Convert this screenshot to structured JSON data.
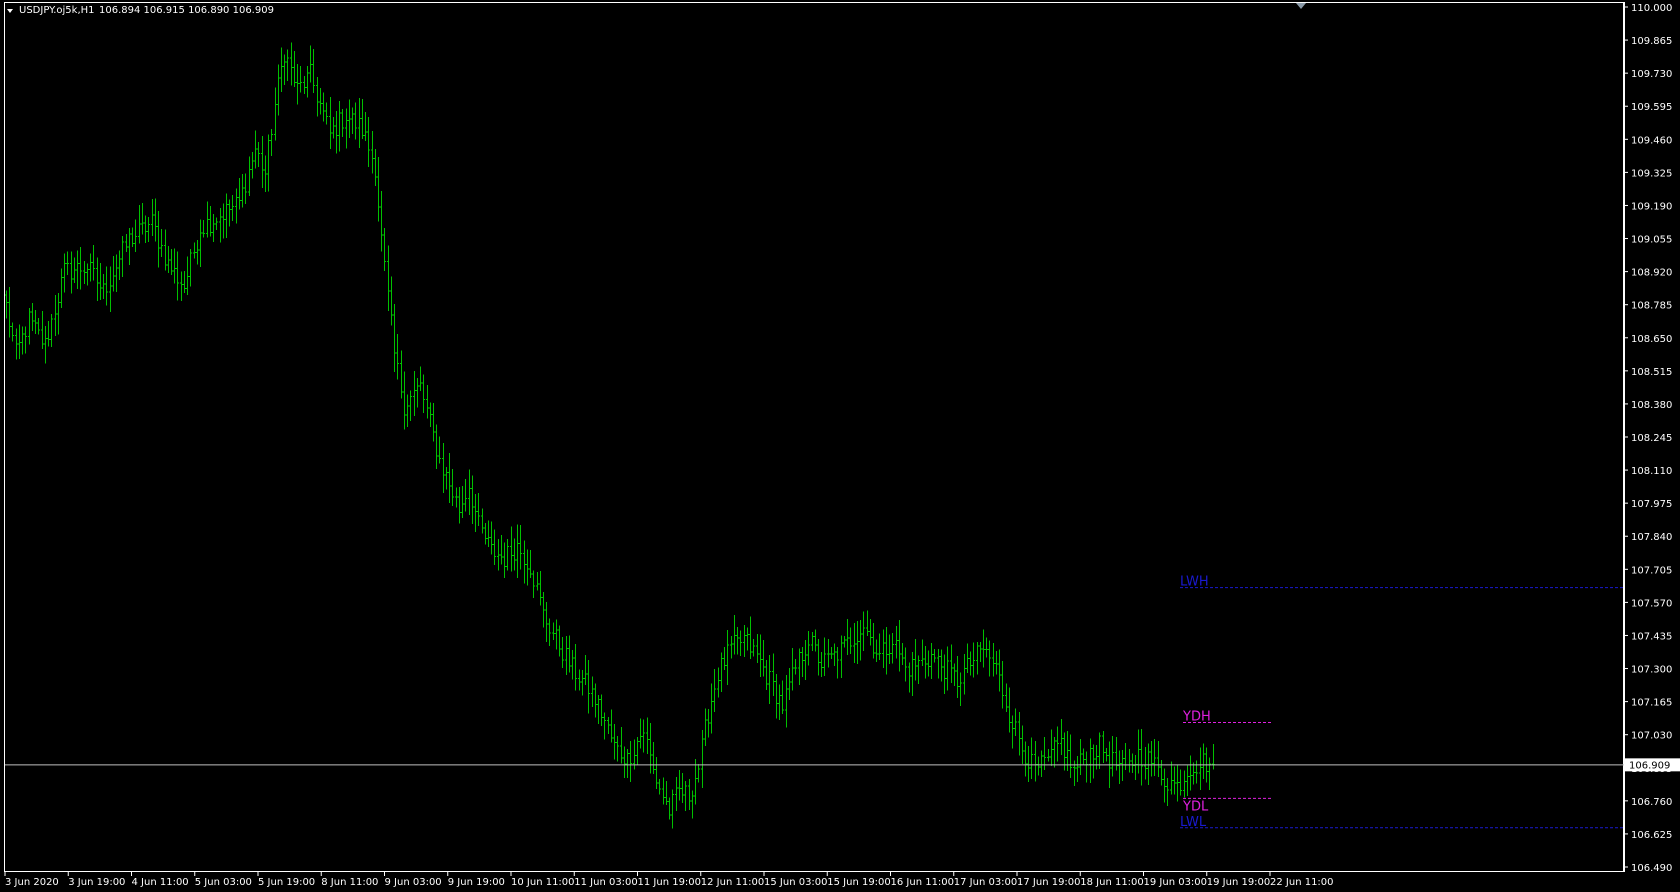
{
  "header": {
    "symbol_timeframe": "USDJPY.oj5k,H1",
    "ohlc": "106.894 106.915 106.890 106.909"
  },
  "colors": {
    "background": "#000000",
    "axis": "#ffffff",
    "bars": "#00c000",
    "bid_line": "#c0c0c0",
    "weekly_levels": "#1a1ad0",
    "daily_levels": "#e020e0"
  },
  "chart_data": {
    "type": "ohlc",
    "symbol": "USDJPY.oj5k",
    "timeframe": "H1",
    "ylim": [
      106.49,
      110.0
    ],
    "y_ticks": [
      "110.000",
      "109.865",
      "109.730",
      "109.595",
      "109.460",
      "109.325",
      "109.190",
      "109.055",
      "108.920",
      "108.785",
      "108.650",
      "108.515",
      "108.380",
      "108.245",
      "108.110",
      "107.975",
      "107.840",
      "107.705",
      "107.570",
      "107.435",
      "107.300",
      "107.165",
      "107.030",
      "106.895",
      "106.760",
      "106.625",
      "106.490"
    ],
    "x_ticks": [
      "3 Jun 2020",
      "3 Jun 19:00",
      "4 Jun 11:00",
      "5 Jun 03:00",
      "5 Jun 19:00",
      "8 Jun 11:00",
      "9 Jun 03:00",
      "9 Jun 19:00",
      "10 Jun 11:00",
      "11 Jun 03:00",
      "11 Jun 19:00",
      "12 Jun 11:00",
      "15 Jun 03:00",
      "15 Jun 19:00",
      "16 Jun 11:00",
      "17 Jun 03:00",
      "17 Jun 19:00",
      "18 Jun 11:00",
      "19 Jun 03:00",
      "19 Jun 19:00",
      "22 Jun 11:00"
    ],
    "close_anchors": [
      [
        0,
        108.78
      ],
      [
        3,
        108.58
      ],
      [
        7,
        108.72
      ],
      [
        12,
        108.62
      ],
      [
        18,
        108.92
      ],
      [
        25,
        108.94
      ],
      [
        30,
        108.84
      ],
      [
        38,
        109.05
      ],
      [
        45,
        109.12
      ],
      [
        50,
        108.95
      ],
      [
        55,
        108.86
      ],
      [
        60,
        109.1
      ],
      [
        66,
        109.15
      ],
      [
        72,
        109.2
      ],
      [
        77,
        109.42
      ],
      [
        80,
        109.32
      ],
      [
        83,
        109.6
      ],
      [
        86,
        109.82
      ],
      [
        90,
        109.66
      ],
      [
        94,
        109.72
      ],
      [
        100,
        109.48
      ],
      [
        105,
        109.56
      ],
      [
        110,
        109.5
      ],
      [
        114,
        109.35
      ],
      [
        116,
        109.05
      ],
      [
        120,
        108.58
      ],
      [
        123,
        108.38
      ],
      [
        128,
        108.45
      ],
      [
        131,
        108.3
      ],
      [
        134,
        108.15
      ],
      [
        137,
        108.05
      ],
      [
        140,
        107.95
      ],
      [
        143,
        108.05
      ],
      [
        146,
        107.88
      ],
      [
        150,
        107.78
      ],
      [
        154,
        107.75
      ],
      [
        158,
        107.8
      ],
      [
        162,
        107.72
      ],
      [
        166,
        107.52
      ],
      [
        170,
        107.42
      ],
      [
        175,
        107.3
      ],
      [
        180,
        107.22
      ],
      [
        184,
        107.12
      ],
      [
        188,
        106.98
      ],
      [
        192,
        106.93
      ],
      [
        197,
        107.05
      ],
      [
        200,
        106.88
      ],
      [
        203,
        106.78
      ],
      [
        205,
        106.72
      ],
      [
        208,
        106.8
      ],
      [
        211,
        106.78
      ],
      [
        214,
        106.9
      ],
      [
        217,
        107.12
      ],
      [
        220,
        107.28
      ],
      [
        224,
        107.38
      ],
      [
        228,
        107.42
      ],
      [
        232,
        107.35
      ],
      [
        236,
        107.25
      ],
      [
        240,
        107.15
      ],
      [
        244,
        107.3
      ],
      [
        248,
        107.42
      ],
      [
        252,
        107.32
      ],
      [
        256,
        107.35
      ],
      [
        260,
        107.4
      ],
      [
        265,
        107.48
      ],
      [
        270,
        107.35
      ],
      [
        274,
        107.42
      ],
      [
        278,
        107.3
      ],
      [
        282,
        107.32
      ],
      [
        286,
        107.35
      ],
      [
        290,
        107.3
      ],
      [
        294,
        107.25
      ],
      [
        298,
        107.32
      ],
      [
        302,
        107.38
      ],
      [
        306,
        107.3
      ],
      [
        310,
        107.12
      ],
      [
        314,
        106.98
      ],
      [
        318,
        106.88
      ],
      [
        322,
        106.92
      ],
      [
        326,
        107.0
      ],
      [
        330,
        106.88
      ],
      [
        334,
        106.95
      ],
      [
        338,
        106.98
      ],
      [
        342,
        106.92
      ],
      [
        346,
        106.88
      ],
      [
        350,
        106.95
      ],
      [
        354,
        106.92
      ],
      [
        358,
        106.85
      ],
      [
        362,
        106.82
      ],
      [
        366,
        106.9
      ],
      [
        370,
        106.92
      ],
      [
        373,
        106.909
      ]
    ],
    "last_price": "106.909",
    "levels": [
      {
        "label": "LWH",
        "value": 107.63,
        "color": "#1a1ad0"
      },
      {
        "label": "YDH",
        "value": 107.08,
        "color": "#e020e0"
      },
      {
        "label": "YDL",
        "value": 106.77,
        "color": "#e020e0"
      },
      {
        "label": "LWL",
        "value": 106.65,
        "color": "#1a1ad0"
      }
    ]
  }
}
